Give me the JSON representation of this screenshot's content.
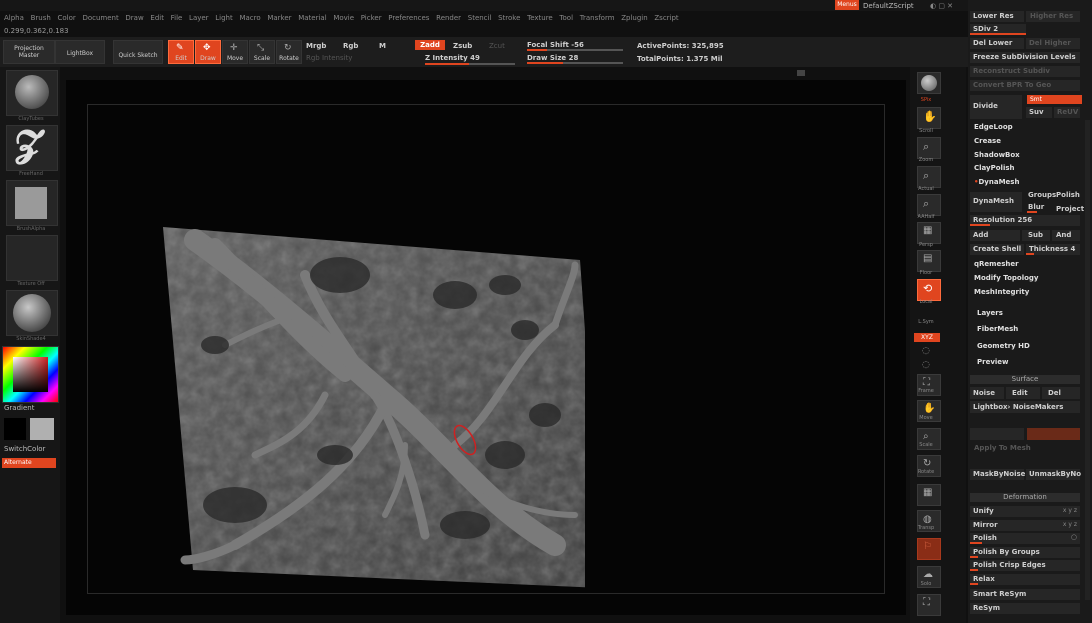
{
  "menu": {
    "items": [
      "Alpha",
      "Brush",
      "Color",
      "Document",
      "Draw",
      "Edit",
      "File",
      "Layer",
      "Light",
      "Macro",
      "Marker",
      "Material",
      "Movie",
      "Picker",
      "Preferences",
      "Render",
      "Stencil",
      "Stroke",
      "Texture",
      "Tool",
      "Transform",
      "Zplugin",
      "Zscript"
    ],
    "top_right": [
      "Menus",
      "DefaultZScript"
    ]
  },
  "coords": "0.299,0.362,0.183",
  "toolbar": {
    "projection_master": "Projection Master",
    "lightbox": "LightBox",
    "quick_sketch": "Quick Sketch",
    "edit": "Edit",
    "draw": "Draw",
    "move": "Move",
    "scale": "Scale",
    "rotate": "Rotate",
    "mrgb": "Mrgb",
    "rgb": "Rgb",
    "m": "M",
    "rgb_intensity": "Rgb Intensity",
    "zadd": "Zadd",
    "zsub": "Zsub",
    "zcut": "Zcut",
    "z_intensity": "Z Intensity 49",
    "focal_shift": "Focal Shift -56",
    "draw_size": "Draw Size 28",
    "active_points": "ActivePoints: 325,895",
    "total_points": "TotalPoints: 1.375 Mil"
  },
  "left_shelf": {
    "items": [
      {
        "caption": "ClayTubes"
      },
      {
        "caption": "FreeHand"
      },
      {
        "caption": "BrushAlpha"
      },
      {
        "caption": "Texture Off"
      },
      {
        "caption": "SkinShade4"
      }
    ],
    "gradient": "Gradient",
    "switch_color": "SwitchColor",
    "alternate": "Alternate"
  },
  "right_shelf": {
    "items": [
      "SPix",
      "Scroll",
      "Zoom",
      "Actual",
      "AAHalf",
      "Persp",
      "Floor",
      "Local",
      "L.Sym",
      "Frame",
      "Move",
      "Scale",
      "Rotate",
      "PolyF",
      "Transp",
      "Ghost",
      "Solo",
      "Xpose"
    ],
    "xyz": "XYZ"
  },
  "panel": {
    "lower_res": "Lower Res",
    "higher_res": "Higher Res",
    "sdiv": "SDiv 2",
    "del_lower": "Del Lower",
    "del_higher": "Del Higher",
    "freeze": "Freeze SubDivision Levels",
    "reconstruct": "Reconstruct Subdiv",
    "convert_bpr": "Convert BPR To Geo",
    "divide": "Divide",
    "smt": "Smt",
    "suv": "Suv",
    "reuv": "ReUV",
    "edgeloop": "EdgeLoop",
    "crease": "Crease",
    "shadowbox": "ShadowBox",
    "claypolish": "ClayPolish",
    "dynamesh_section": "DynaMesh",
    "dynamesh": "DynaMesh",
    "groups": "Groups",
    "polish": "Polish",
    "blur": "Blur",
    "project": "Project",
    "resolution": "Resolution 256",
    "add": "Add",
    "sub": "Sub",
    "and": "And",
    "create_shell": "Create Shell",
    "thickness": "Thickness 4",
    "zremesher": "qRemesher",
    "modify_topology": "Modify Topology",
    "meshintegrity": "MeshIntegrity",
    "layers": "Layers",
    "fibermesh": "FiberMesh",
    "geometry_hd": "Geometry HD",
    "preview": "Preview",
    "surface": "Surface",
    "noise": "Noise",
    "edit": "Edit",
    "del": "Del",
    "lightbox_noise": "Lightbox› NoiseMakers",
    "apply_to_mesh": "Apply To Mesh",
    "maskbynoise": "MaskByNoise",
    "unmask": "UnmaskByNo",
    "deformation": "Deformation",
    "unify": "Unify",
    "mirror": "Mirror",
    "polish_def": "Polish",
    "polish_groups": "Polish By Groups",
    "polish_crisp": "Polish Crisp Edges",
    "relax": "Relax",
    "smart_resym": "Smart ReSym",
    "resym": "ReSym"
  }
}
